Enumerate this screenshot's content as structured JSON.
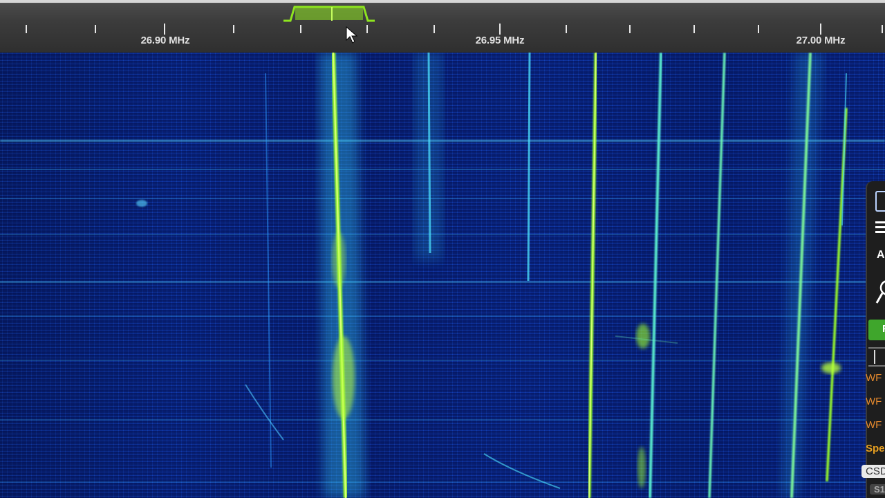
{
  "scale": {
    "labels": [
      "26.90 MHz",
      "26.95 MHz",
      "27.00 MHz"
    ]
  },
  "side_panel": {
    "a_label": "A",
    "green_label": "F",
    "wf_buttons": [
      "WF",
      "WF",
      "WF"
    ],
    "spe_label": "Spe",
    "csd_label": "CSD",
    "s1_label": "S1"
  },
  "colors": {
    "waterfall_bg": "#0c34a8",
    "signal_green": "#9cff2a",
    "signal_cyan": "#4fe6ff",
    "passband": "#8ee51f",
    "scale_bg": "#3c3c3c"
  },
  "icons": {
    "cursor": "mouse-pointer-icon",
    "menu": "hamburger-menu-icon",
    "zoom": "magnifier-icon",
    "mode": "square-bracket-icon"
  }
}
